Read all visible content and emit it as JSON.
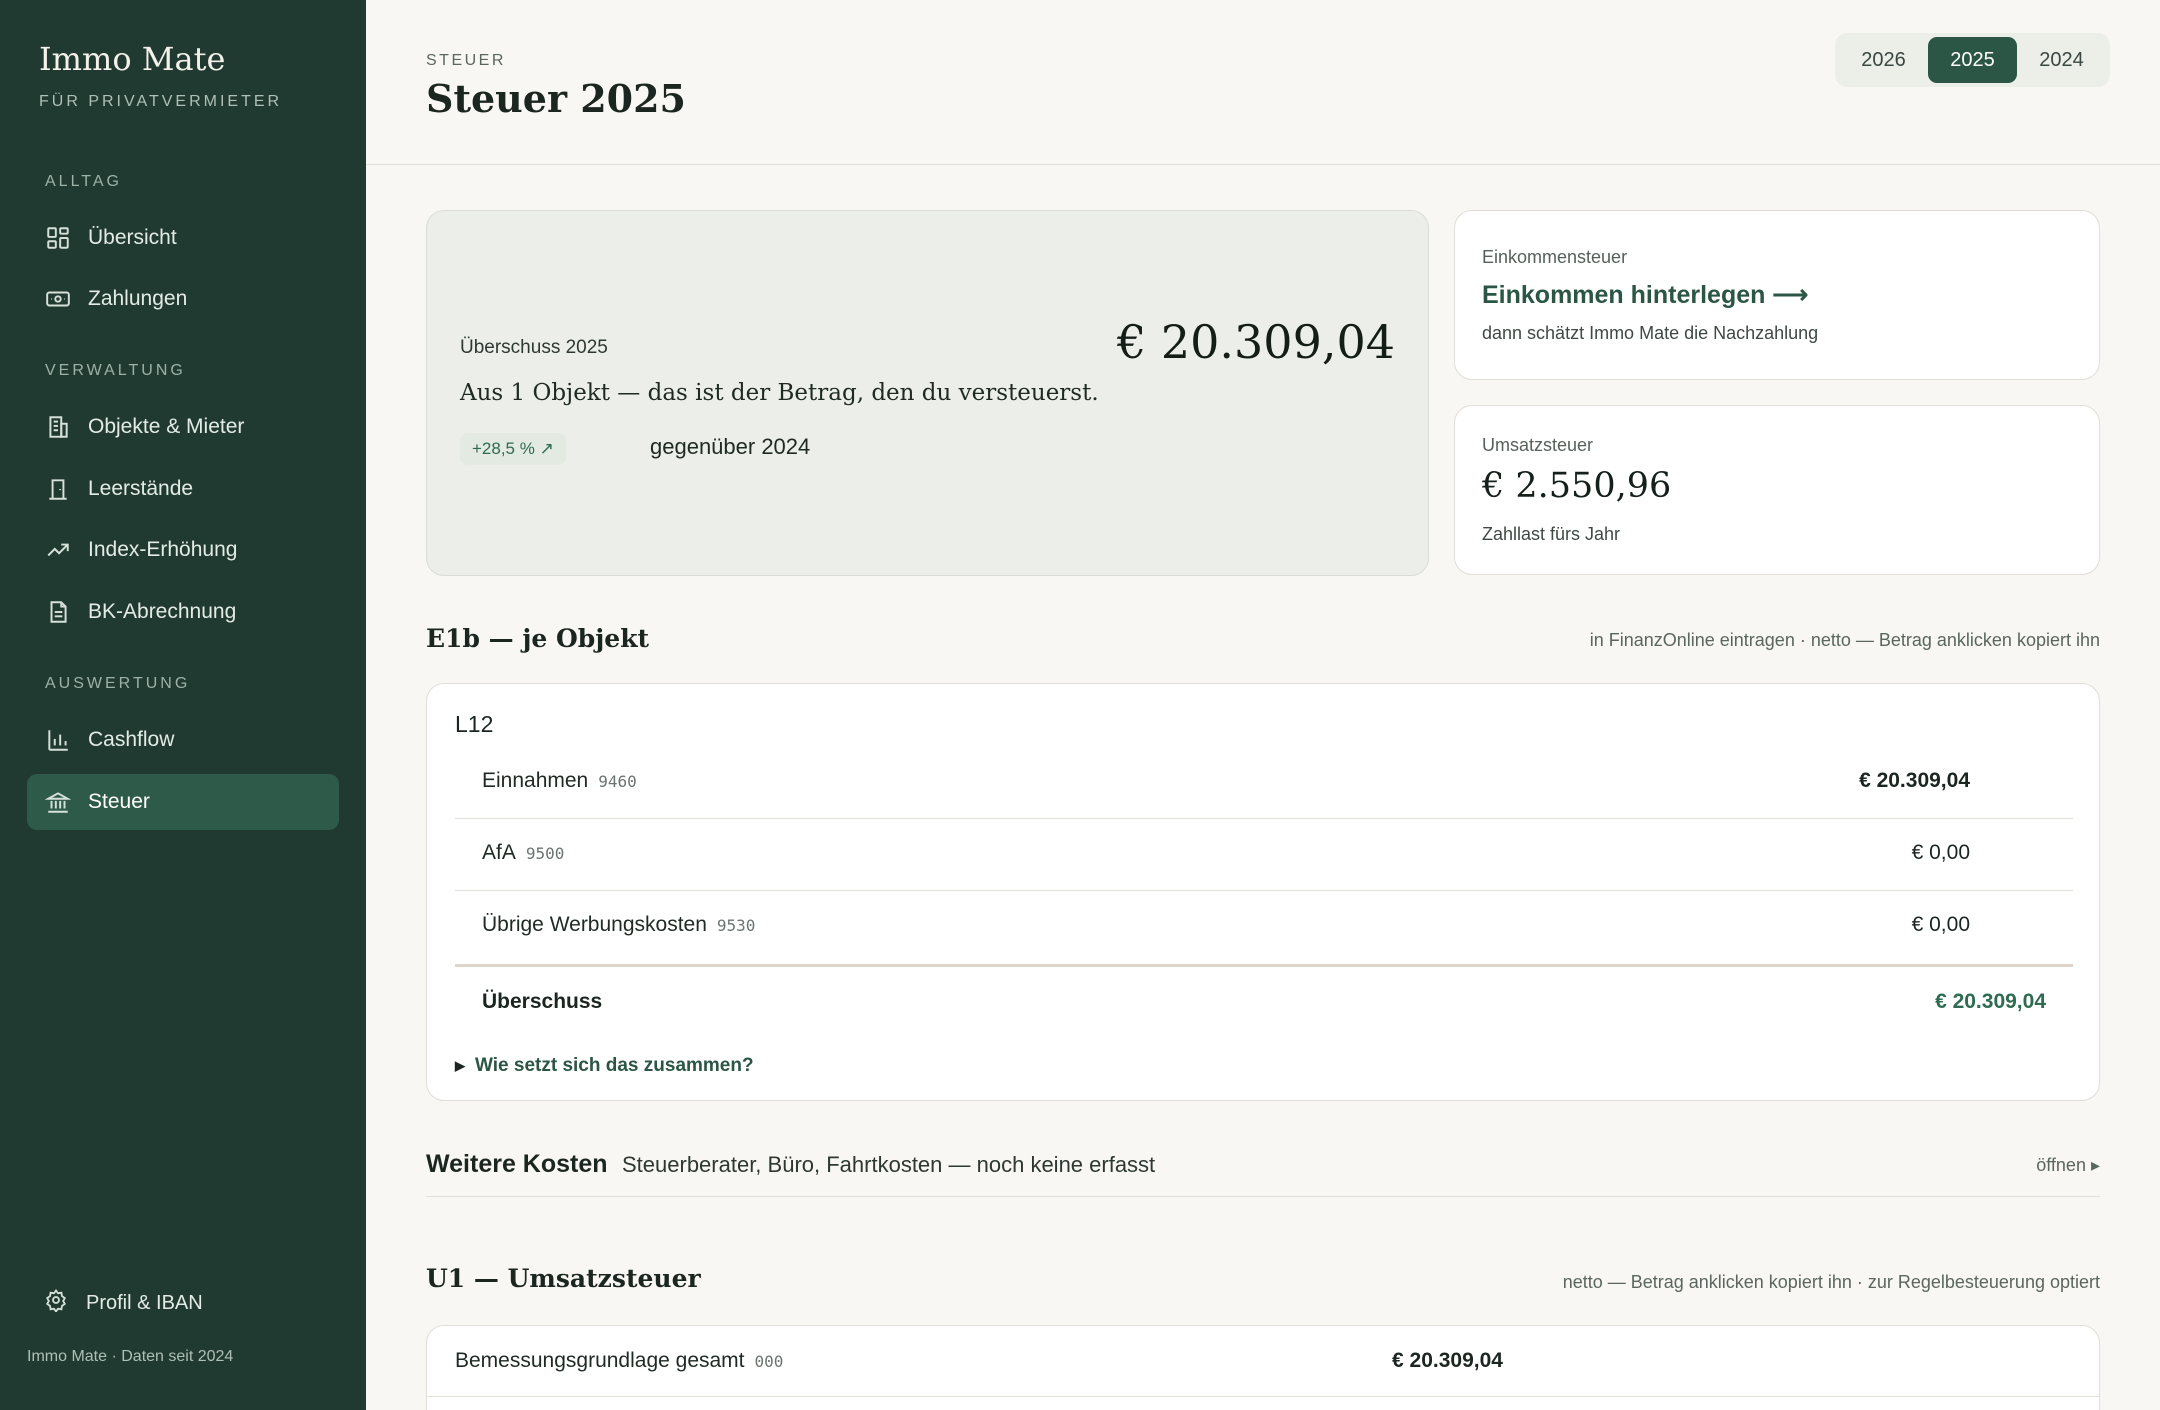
{
  "brand": {
    "name": "Immo Mate",
    "tagline": "FÜR PRIVATVERMIETER"
  },
  "sidebar": {
    "sections": [
      {
        "title": "ALLTAG",
        "items": [
          {
            "label": "Übersicht",
            "icon": "grid-icon"
          },
          {
            "label": "Zahlungen",
            "icon": "cash-icon"
          }
        ]
      },
      {
        "title": "VERWALTUNG",
        "items": [
          {
            "label": "Objekte & Mieter",
            "icon": "building-icon"
          },
          {
            "label": "Leerstände",
            "icon": "door-icon"
          },
          {
            "label": "Index-Erhöhung",
            "icon": "trend-up-icon"
          },
          {
            "label": "BK-Abrechnung",
            "icon": "document-icon"
          }
        ]
      },
      {
        "title": "AUSWERTUNG",
        "items": [
          {
            "label": "Cashflow",
            "icon": "bar-chart-icon"
          },
          {
            "label": "Steuer",
            "icon": "bank-icon",
            "active": true
          }
        ]
      }
    ],
    "footer_item": {
      "label": "Profil & IBAN",
      "icon": "gear-icon"
    },
    "meta": "Immo Mate · Daten seit 2024"
  },
  "header": {
    "eyebrow": "STEUER",
    "title": "Steuer 2025",
    "years": [
      {
        "label": "2026"
      },
      {
        "label": "2025",
        "active": true
      },
      {
        "label": "2024"
      }
    ]
  },
  "hero": {
    "label": "Überschuss 2025",
    "amount": "€ 20.309,04",
    "description": "Aus 1 Objekt — das ist der Betrag, den du versteuerst.",
    "badge": "+28,5 % ↗",
    "compare": "gegenüber 2024"
  },
  "income_tax": {
    "label": "Einkommensteuer",
    "link": "Einkommen hinterlegen ⟶",
    "note": "dann schätzt Immo Mate die Nachzahlung"
  },
  "vat": {
    "label": "Umsatzsteuer",
    "value": "€ 2.550,96",
    "note": "Zahllast fürs Jahr"
  },
  "e1b": {
    "title": "E1b — je Objekt",
    "note": "in FinanzOnline eintragen · netto — Betrag anklicken kopiert ihn",
    "object_name": "L12",
    "rows": [
      {
        "label": "Einnahmen",
        "code": "9460",
        "value": "€ 20.309,04"
      },
      {
        "label": "AfA",
        "code": "9500",
        "value": "€ 0,00"
      },
      {
        "label": "Übrige Werbungskosten",
        "code": "9530",
        "value": "€ 0,00"
      }
    ],
    "total_label": "Überschuss",
    "total_value": "€ 20.309,04",
    "details": "Wie setzt sich das zusammen?"
  },
  "more_costs": {
    "title": "Weitere Kosten",
    "description": "Steuerberater, Büro, Fahrtkosten — noch keine erfasst",
    "open": "öffnen ▸"
  },
  "u1": {
    "title": "U1 — Umsatzsteuer",
    "note": "netto — Betrag anklicken kopiert ihn · zur Regelbesteuerung optiert",
    "rows": [
      {
        "label": "Bemessungsgrundlage gesamt",
        "code": "000",
        "value": "€ 20.309,04"
      }
    ]
  },
  "colors": {
    "sidebar_bg": "#213a31",
    "accent": "#2b5646",
    "positive": "#2e6b50",
    "page_bg": "#f8f7f3"
  }
}
